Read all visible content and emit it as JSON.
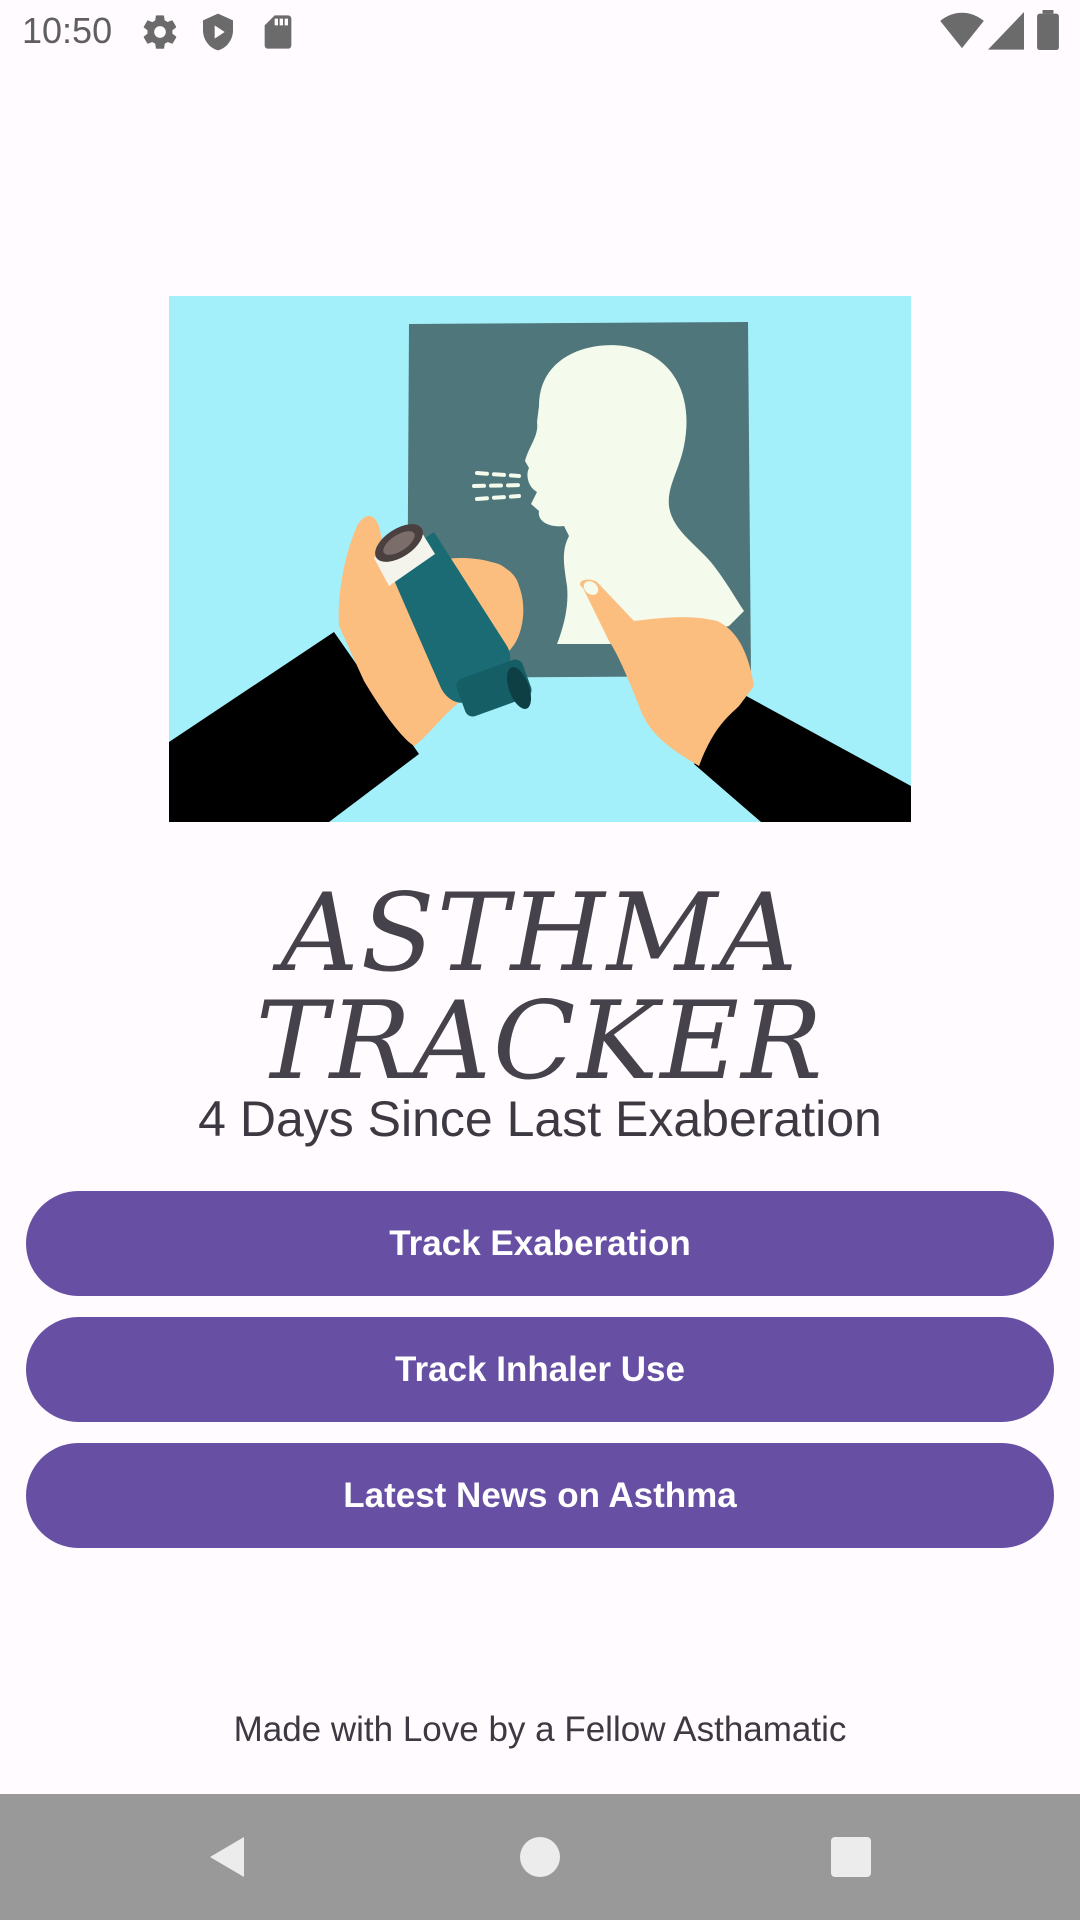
{
  "status_bar": {
    "time": "10:50",
    "left_icons": [
      "gear-icon",
      "shield-play-icon",
      "sd-card-icon"
    ],
    "right_icons": [
      "wifi-icon",
      "signal-icon",
      "battery-icon"
    ]
  },
  "hero": {
    "image_name": "inhaler-illustration"
  },
  "app_title": "ASTHMA TRACKER",
  "days_counter": "4 Days Since Last Exaberation",
  "buttons": {
    "track_exaberation": "Track Exaberation",
    "track_inhaler": "Track Inhaler Use",
    "latest_news": "Latest News on Asthma"
  },
  "footer": "Made with Love by a Fellow Asthamatic",
  "colors": {
    "background": "#fffbfe",
    "primary": "#6750a4",
    "on_primary": "#ffffff",
    "text": "#3d3942",
    "nav_bar": "#9a999a"
  },
  "nav_bar": {
    "icons": [
      "back-icon",
      "home-icon",
      "recents-icon"
    ]
  }
}
